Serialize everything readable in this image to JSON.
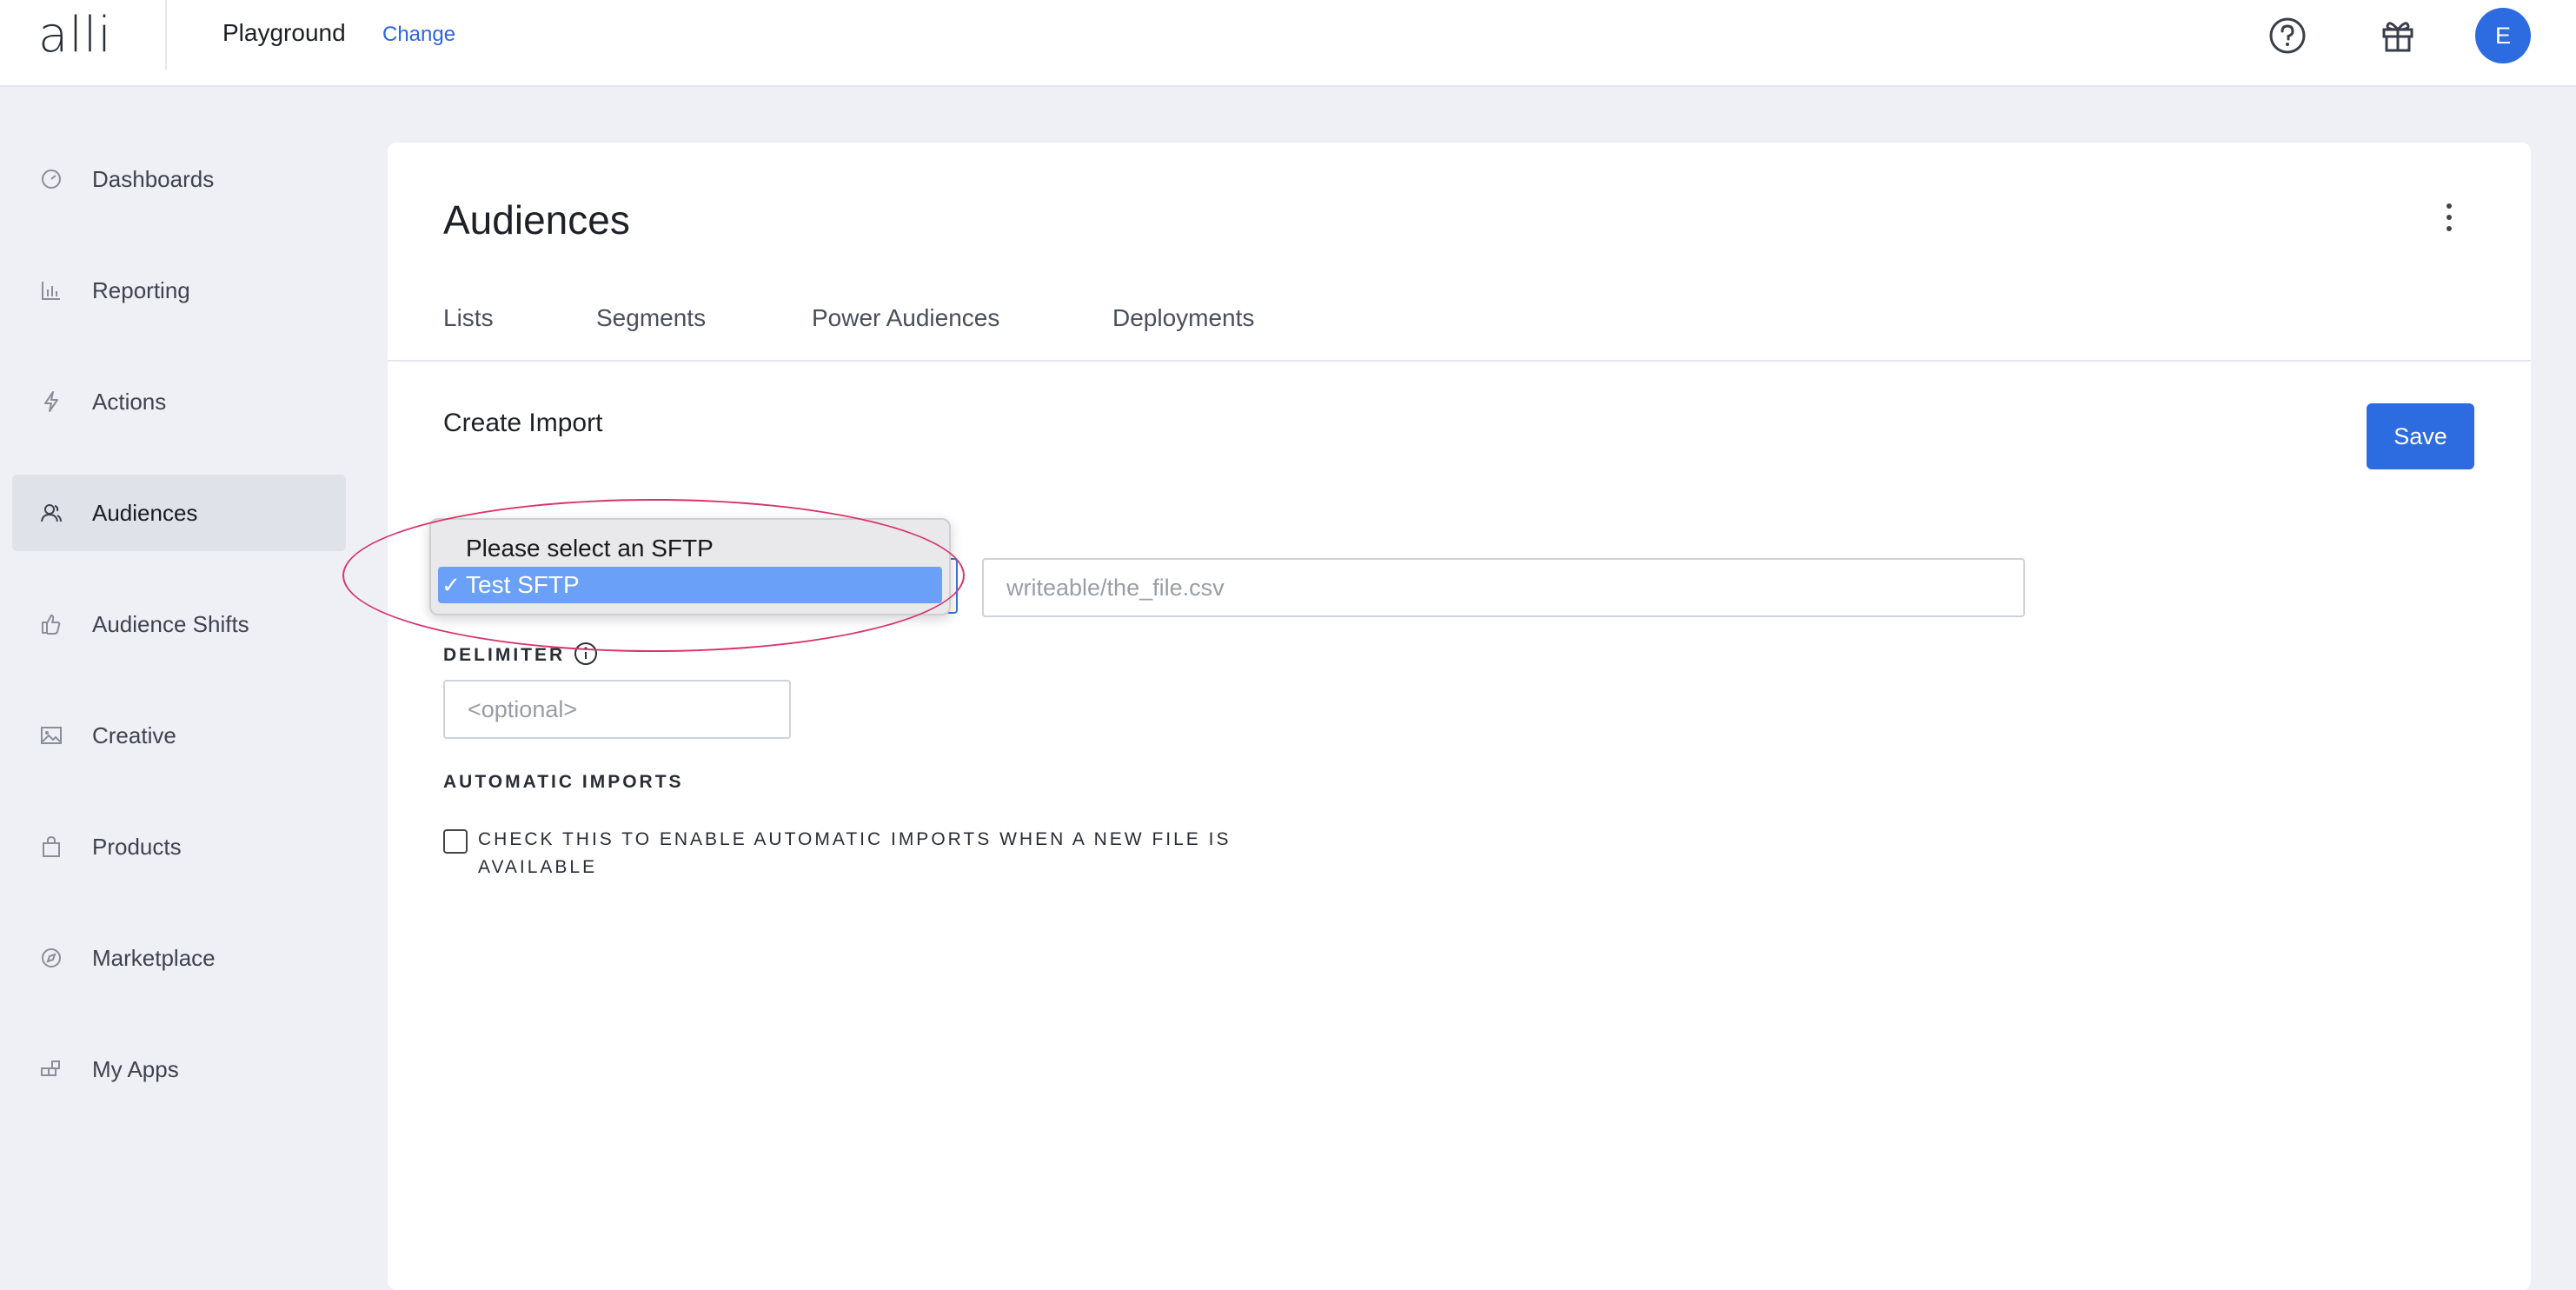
{
  "header": {
    "logo": "alli",
    "org_name": "Playground",
    "change_label": "Change",
    "avatar_initial": "E"
  },
  "sidebar": {
    "items": [
      {
        "label": "Dashboards",
        "icon": "gauge-icon"
      },
      {
        "label": "Reporting",
        "icon": "bar-chart-icon"
      },
      {
        "label": "Actions",
        "icon": "lightning-icon"
      },
      {
        "label": "Audiences",
        "icon": "users-icon",
        "active": true
      },
      {
        "label": "Audience Shifts",
        "icon": "thumbs-up-icon"
      },
      {
        "label": "Creative",
        "icon": "image-icon"
      },
      {
        "label": "Products",
        "icon": "shopping-bag-icon"
      },
      {
        "label": "Marketplace",
        "icon": "compass-icon"
      },
      {
        "label": "My Apps",
        "icon": "apps-icon"
      }
    ]
  },
  "main": {
    "title": "Audiences",
    "tabs": [
      {
        "label": "Lists"
      },
      {
        "label": "Segments"
      },
      {
        "label": "Power Audiences"
      },
      {
        "label": "Deployments"
      }
    ],
    "section_title": "Create Import",
    "save_label": "Save",
    "path_placeholder": "writeable/the_file.csv",
    "delimiter_label": "DELIMITER",
    "delimiter_placeholder": "<optional>",
    "automatic_imports_label": "AUTOMATIC IMPORTS",
    "checkbox_label": "CHECK THIS TO ENABLE AUTOMATIC IMPORTS WHEN A NEW FILE IS AVAILABLE",
    "checkbox_checked": false
  },
  "dropdown": {
    "options": [
      {
        "label": "Please select an SFTP",
        "selected": false
      },
      {
        "label": "Test SFTP",
        "selected": true
      }
    ],
    "check_glyph": "✓"
  },
  "colors": {
    "accent": "#2c6be0",
    "annotation": "#d7356a",
    "selected_option": "#6aa0f7"
  }
}
